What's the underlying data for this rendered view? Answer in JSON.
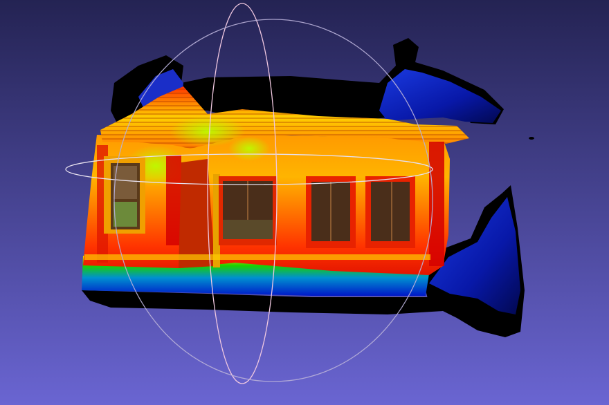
{
  "viewer": {
    "background_top": "#242353",
    "background_bottom": "#6a65d2",
    "trackball_color": "#d8cde0"
  },
  "mesh": {
    "colormap": [
      "#0018c8",
      "#1ad000",
      "#ffdd00",
      "#ff3300",
      "#d40000"
    ],
    "shadow_color": "#000000",
    "window_count": 4
  }
}
